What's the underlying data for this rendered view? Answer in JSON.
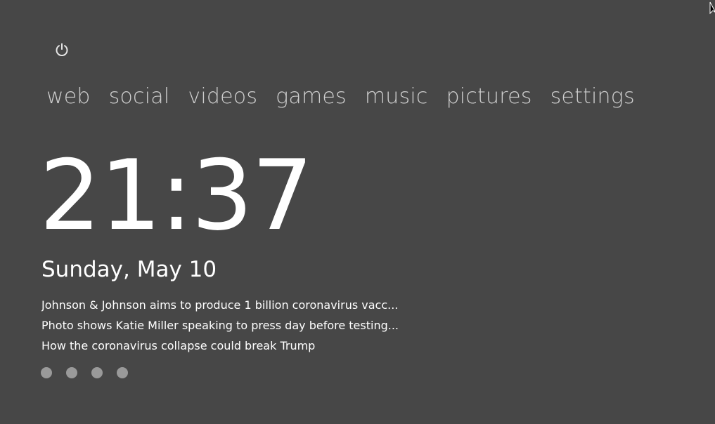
{
  "power": {
    "icon": "power-icon"
  },
  "nav": {
    "items": [
      {
        "label": "web"
      },
      {
        "label": "social"
      },
      {
        "label": "videos"
      },
      {
        "label": "games"
      },
      {
        "label": "music"
      },
      {
        "label": "pictures"
      },
      {
        "label": "settings"
      }
    ]
  },
  "clock": {
    "time": "21:37",
    "date": "Sunday, May 10"
  },
  "news": {
    "headlines": [
      {
        "text": "Johnson & Johnson aims to produce 1 billion coronavirus vacc..."
      },
      {
        "text": "Photo shows Katie Miller speaking to press day before testing..."
      },
      {
        "text": "How the coronavirus collapse could break Trump"
      }
    ]
  },
  "pager": {
    "pages": 4,
    "dot_color": "#9a9a9a"
  },
  "colors": {
    "background": "#474747",
    "text": "#ffffff",
    "nav_text": "#cfcfcf"
  }
}
